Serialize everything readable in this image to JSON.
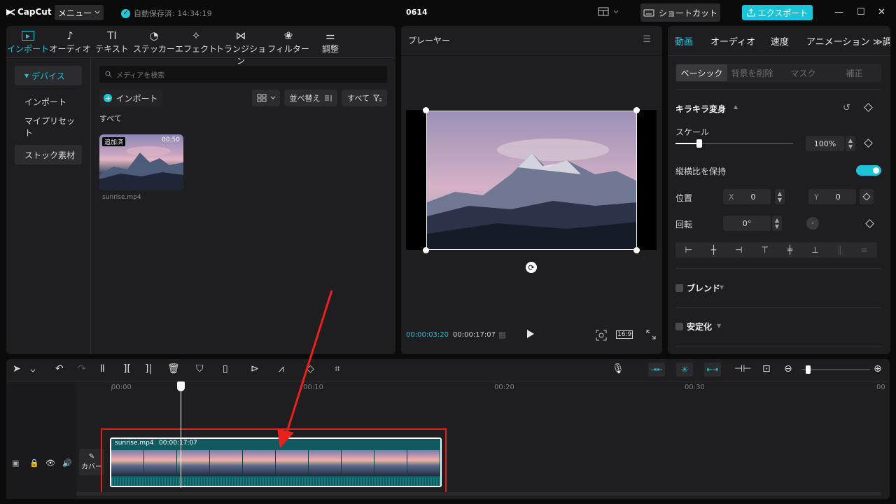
{
  "app": {
    "name": "CapCut",
    "menu": "メニュー",
    "autosave": "自動保存済: 14:34:19",
    "project": "0614",
    "shortcut": "ショートカット",
    "export": "エクスポート"
  },
  "toolbar": [
    {
      "label": "インポート",
      "icon": "import-icon"
    },
    {
      "label": "オーディオ",
      "icon": "audio-icon"
    },
    {
      "label": "テキスト",
      "icon": "text-icon"
    },
    {
      "label": "ステッカー",
      "icon": "sticker-icon"
    },
    {
      "label": "エフェクト",
      "icon": "effect-icon"
    },
    {
      "label": "トランジション",
      "icon": "transition-icon"
    },
    {
      "label": "フィルター",
      "icon": "filter-icon"
    },
    {
      "label": "調整",
      "icon": "adjust-icon"
    }
  ],
  "sidebar": {
    "items": [
      "デバイス",
      "インポート",
      "マイプリセット",
      "ストック素材"
    ]
  },
  "media": {
    "search_placeholder": "メディアを検索",
    "import": "インポート",
    "sort": "並べ替え",
    "filter": "すべて",
    "section": "すべて",
    "clip": {
      "badge": "追加済",
      "duration": "00:50",
      "name": "sunrise.mp4"
    }
  },
  "player": {
    "title": "プレーヤー",
    "current": "00:00:03:20",
    "total": "00:00:17:07",
    "ratio": "16:9"
  },
  "props": {
    "tabs": [
      "動画",
      "オーディオ",
      "速度",
      "アニメーション",
      "≫調"
    ],
    "subtabs": [
      "ベーシック",
      "背景を削除",
      "マスク",
      "補正"
    ],
    "section": "キラキラ変身",
    "scale_label": "スケール",
    "scale_value": "100%",
    "scale_fraction": 0.2,
    "keep_ratio": "縦横比を保持",
    "position_label": "位置",
    "x_label": "X",
    "x_value": "0",
    "y_label": "Y",
    "y_value": "0",
    "rotation_label": "回転",
    "rotation_value": "0°",
    "blend": "ブレンド",
    "stabilize": "安定化"
  },
  "timeline": {
    "ruler": [
      "00:00",
      "00:10",
      "00:20",
      "00:30",
      "00"
    ],
    "clip_name": "sunrise.mp4",
    "clip_duration": "00:00:17:07",
    "cover": "カバー"
  },
  "colors": {
    "accent": "#1bc4d7",
    "clip": "#0f5a5e",
    "highlight": "#e0201f",
    "arrow": "#e8211d"
  }
}
